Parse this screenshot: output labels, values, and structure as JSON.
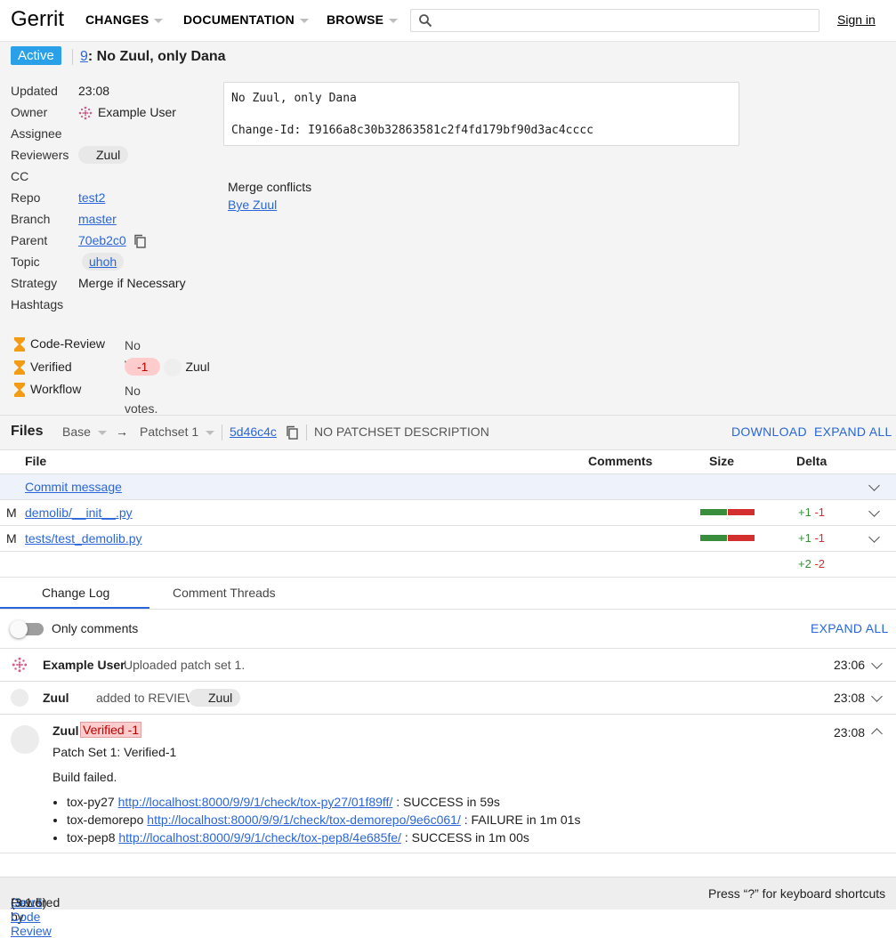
{
  "header": {
    "logo": "Gerrit",
    "menus": [
      "CHANGES",
      "DOCUMENTATION",
      "BROWSE"
    ],
    "search_placeholder": "",
    "sign_in": "Sign in"
  },
  "change": {
    "status": "Active",
    "number": "9",
    "subject": ": No Zuul, only Dana"
  },
  "metadata": {
    "updated_label": "Updated",
    "updated": "23:08",
    "owner_label": "Owner",
    "owner": "Example User",
    "assignee_label": "Assignee",
    "reviewers_label": "Reviewers",
    "reviewer": "Zuul",
    "cc_label": "CC",
    "repo_label": "Repo",
    "repo": "test2",
    "branch_label": "Branch",
    "branch": "master",
    "parent_label": "Parent",
    "parent": "70eb2c0",
    "topic_label": "Topic",
    "topic": "uhoh",
    "strategy_label": "Strategy",
    "strategy": "Merge if Necessary",
    "hashtags_label": "Hashtags"
  },
  "commit_message": {
    "line1": "No Zuul, only Dana",
    "line2": "Change-Id: I9166a8c30b32863581c2f4fd179bf90d3ac4cccc"
  },
  "merge_conflicts": {
    "title": "Merge conflicts",
    "link": "Bye Zuul"
  },
  "labels": [
    {
      "name": "Code-Review",
      "value": "No votes."
    },
    {
      "name": "Verified",
      "vote": "-1",
      "voter": "Zuul"
    },
    {
      "name": "Workflow",
      "value": "No votes."
    }
  ],
  "files": {
    "title": "Files",
    "base": "Base",
    "arrow": "→",
    "patchset": "Patchset 1",
    "commit": "5d46c4c",
    "description": "NO PATCHSET DESCRIPTION",
    "download": "DOWNLOAD",
    "expand_all": "EXPAND ALL",
    "columns": {
      "file": "File",
      "comments": "Comments",
      "size": "Size",
      "delta": "Delta"
    },
    "commit_message_row": "Commit message",
    "rows": [
      {
        "status": "M",
        "path": "demolib/__init__.py",
        "added": "+1",
        "removed": "-1"
      },
      {
        "status": "M",
        "path": "tests/test_demolib.py",
        "added": "+1",
        "removed": "-1"
      }
    ],
    "total_added": "+2",
    "total_removed": "-2"
  },
  "tabs": [
    "Change Log",
    "Comment Threads"
  ],
  "changelog": {
    "only_comments": "Only comments",
    "expand_all": "EXPAND ALL",
    "entries": [
      {
        "author": "Example User",
        "text": "Uploaded patch set 1.",
        "time": "23:06"
      },
      {
        "author": "Zuul",
        "text": "added to REVIEWER:",
        "chip": "Zuul",
        "time": "23:08"
      },
      {
        "author": "Zuul",
        "badge": "Verified -1",
        "time": "23:08",
        "patchset": "Patch Set 1: Verified-1",
        "body": "Build failed.",
        "builds": [
          {
            "name": "tox-py27",
            "url": "http://localhost:8000/9/9/1/check/tox-py27/01f89ff/",
            "result": ": SUCCESS in 59s"
          },
          {
            "name": "tox-demorepo",
            "url": "http://localhost:8000/9/9/1/check/tox-demorepo/9e6c061/",
            "result": ": FAILURE in 1m 01s"
          },
          {
            "name": "tox-pep8",
            "url": "http://localhost:8000/9/9/1/check/tox-pep8/4e685fe/",
            "result": ": SUCCESS in 1m 00s"
          }
        ]
      }
    ]
  },
  "footer": {
    "powered_by": "Powered by",
    "gerrit_link": "Gerrit Code Review",
    "version": "(3.1.5)",
    "shortcuts": "Press “?” for keyboard shortcuts"
  },
  "colors": {
    "accent": "#2a66d9",
    "active_status": "#29a0e8",
    "negative_vote": "#ffcccd",
    "added": "#388e3c",
    "removed": "#d32f2f"
  }
}
